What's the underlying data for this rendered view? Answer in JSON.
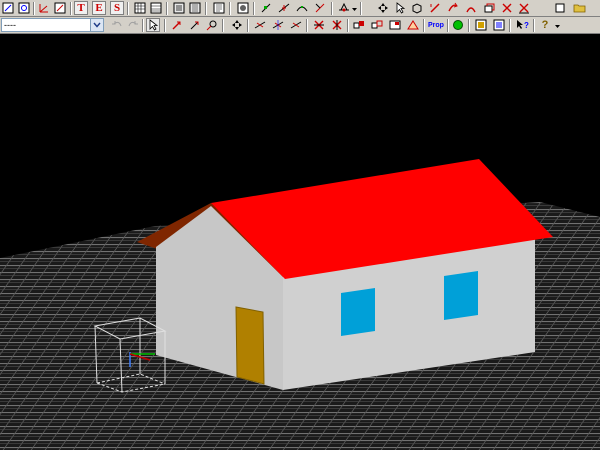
{
  "toolbar": {
    "letter_buttons": [
      "T",
      "E",
      "S"
    ],
    "prop_label": "Prop",
    "help_glyph": "?"
  },
  "layer_select": {
    "value": "----"
  },
  "icons": {
    "row1": [
      "rotate-view-icon",
      "zoom-window-icon",
      "axis-icon",
      "new-window-icon",
      "text-tool-icon",
      "edit-tool-icon",
      "save-tool-icon",
      "grid-icon",
      "table-icon",
      "scan-icon",
      "list-icon",
      "layout-icon",
      "render-icon",
      "snap-node-icon",
      "line-draw-icon",
      "curve-draw-icon",
      "measure-icon",
      "snap-point-icon",
      "pan-icon",
      "select-arrow-icon",
      "box-icon",
      "undo-arrow-icon",
      "redo-arrow-icon",
      "mirror-icon",
      "copy-icon",
      "trim-icon",
      "extend-icon",
      "rectangle-icon",
      "open-folder-icon"
    ],
    "row2": [
      "undo-icon",
      "redo-icon",
      "pointer-icon",
      "move-icon",
      "rotate-icon",
      "scale-icon",
      "pan-icon",
      "snap-icon",
      "align-icon",
      "distribute-icon",
      "group-icon",
      "ungroup-icon",
      "copy-icon",
      "array-icon",
      "triangle-icon",
      "properties-icon",
      "green-light-icon",
      "material-icon",
      "texture-icon",
      "whats-this-icon",
      "help-icon"
    ]
  },
  "colors": {
    "roof": "#ff0000",
    "roof_gable": "#7f2600",
    "wall": "#c7c7c7",
    "window": "#00a0d8",
    "door": "#b08000",
    "ground_grid": "#707070",
    "background": "#000000"
  }
}
